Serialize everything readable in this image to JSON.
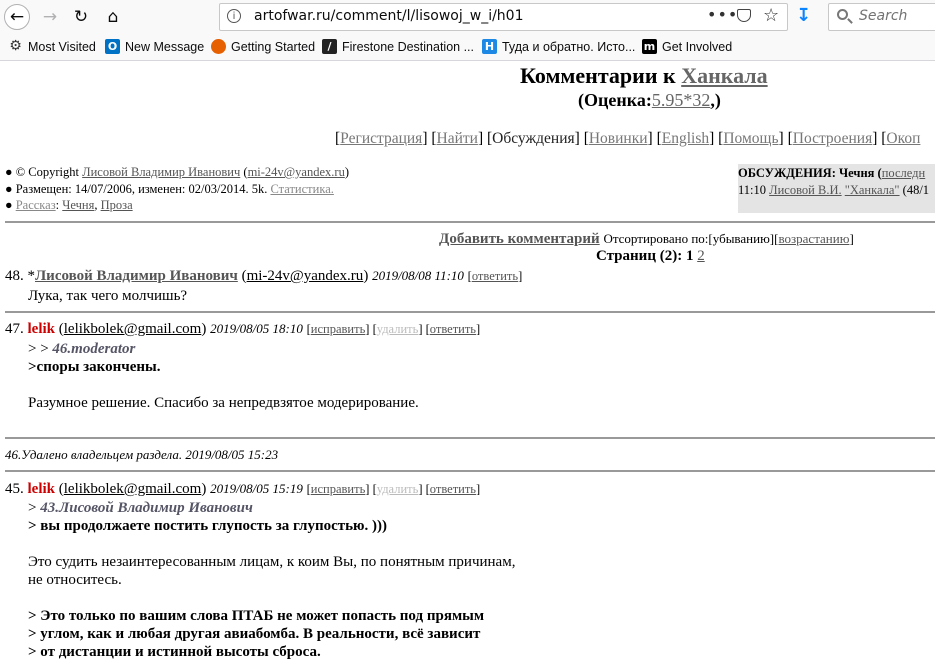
{
  "browser": {
    "url": "artofwar.ru/comment/l/lisowoj_w_i/h01",
    "search_placeholder": "Search",
    "bookmarks": [
      "Most Visited",
      "New Message",
      "Getting Started",
      "Firestone Destination ...",
      "Туда и обратно. Исто...",
      "Get Involved"
    ]
  },
  "page": {
    "title_prefix": "Комментарии к",
    "title_link": "Ханкала",
    "rating_prefix": "(Оценка:",
    "rating_value": "5.95*32",
    "rating_suffix": ",)",
    "menu": [
      "Регистрация",
      "Найти",
      "Обсуждения",
      "Новинки",
      "English",
      "Помощь",
      "Построения",
      "Окоп"
    ],
    "copyright_prefix": "© Copyright",
    "author_name": "Лисовой Владимир Иванович",
    "author_email": "mi-24v@yandex.ru",
    "placed": "Размещен: 14/07/2006, изменен: 02/03/2014. 5k.",
    "stats_link": "Статистика.",
    "tags": [
      "Рассказ",
      "Чечня",
      "Проза"
    ],
    "discuss_label": "ОБСУЖДЕНИЯ: Чечня",
    "discuss_last": "последн",
    "discuss_time": "11:10",
    "discuss_author": "Лисовой В.И.",
    "discuss_title": "\"Ханкала\"",
    "discuss_count": "(48/1",
    "add_comment": "Добавить комментарий",
    "sorted_prefix": "Отсортировано по:",
    "sort_desc": "[убыванию]",
    "sort_asc": "возрастанию",
    "pages_label": "Страниц (2):",
    "page_current": "1",
    "page_next": "2"
  },
  "comments": {
    "c48": {
      "num": "48. *",
      "author": "Лисовой Владимир Иванович",
      "email": "mi-24v@yandex.ru",
      "date": "2019/08/08 11:10",
      "reply": "ответить",
      "text": "Лука, так чего молчишь?"
    },
    "c47": {
      "num": "47.",
      "author": "lelik",
      "email": "lelikbolek@gmail.com",
      "date": "2019/08/05 18:10",
      "edit": "исправить",
      "delete": "удалить",
      "reply": "ответить",
      "quote_prefix": "> >",
      "quote_ref": "46.moderator",
      "quote_text": ">споры закончены.",
      "text": "Разумное решение. Спасибо за непредвзятое модерирование."
    },
    "c46": {
      "num": "46.",
      "text": "Удалено владельцем раздела. 2019/08/05 15:23"
    },
    "c45": {
      "num": "45.",
      "author": "lelik",
      "email": "lelikbolek@gmail.com",
      "date": "2019/08/05 15:19",
      "edit": "исправить",
      "delete": "удалить",
      "reply": "ответить",
      "quote_prefix": ">",
      "quote_ref": "43.Лисовой Владимир Иванович",
      "quote_text": "> вы продолжаете постить глупость за глупостью. )))",
      "text_line1": "Это судить незаинтересованным лицам, к коим Вы, по понятным причинам,",
      "text_line2": "не относитесь.",
      "quote2_line1": "> Это только по вашим слова ПТАБ не может попасть под прямым",
      "quote2_line2": "> углом, как и любая другая авиабомба. В реальности, всё зависит",
      "quote2_line3": "> от дистанции и истинной высоты сброса."
    }
  }
}
